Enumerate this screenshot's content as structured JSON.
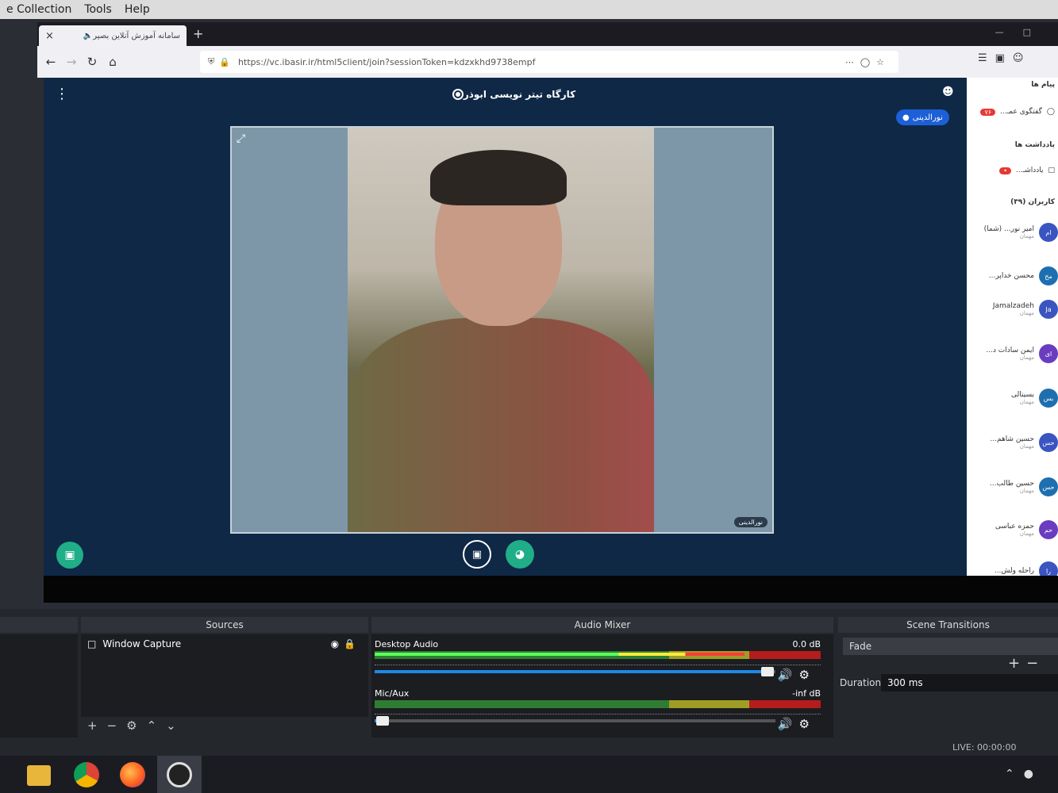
{
  "obs_menu": {
    "collection": "e Collection",
    "tools": "Tools",
    "help": "Help"
  },
  "browser": {
    "tab_title": "سامانه آموزش آنلاین بصیر",
    "tab_audio_icon": "speaker-icon",
    "url": "https://vc.ibasir.ir/html5client/join?sessionToken=kdzxkhd9738empf",
    "nav_icons": [
      "back-icon",
      "forward-icon",
      "reload-icon",
      "home-icon"
    ]
  },
  "webapp": {
    "room_title": "کارگاه تیتر نویسی ابوذر",
    "presenter_badge": "نورالدینی",
    "video_name_tag": "نورالدینی",
    "bg_color": "#0f2846"
  },
  "side_panel": {
    "users_header": "کاربران (۳۹)",
    "messages_header": "پیام ها",
    "chat_label": "گفتگوی عمـ...",
    "chat_badge": "۷۶",
    "notes_header": "یادداشت ها",
    "notes_label": "یادداشـ...",
    "users": [
      {
        "initials": "ام",
        "name": "امیر نور... (شما)",
        "status": "مهمان"
      },
      {
        "initials": "مح",
        "name": "محسن خداپر...",
        "status": ""
      },
      {
        "initials": "Ja",
        "name": "Jamalzadeh",
        "status": "مهمان"
      },
      {
        "initials": "ای",
        "name": "ایمن سادات د...",
        "status": "مهمان"
      },
      {
        "initials": "بس",
        "name": "بسیتالی",
        "status": "مهمان"
      },
      {
        "initials": "حس",
        "name": "حسین شاهم...",
        "status": "مهمان"
      },
      {
        "initials": "حس",
        "name": "حسین طالب...",
        "status": "مهمان"
      },
      {
        "initials": "حم",
        "name": "حمزه عباسی",
        "status": "مهمان"
      },
      {
        "initials": "را",
        "name": "راحله ولش...",
        "status": ""
      }
    ]
  },
  "obs": {
    "sources_title": "Sources",
    "mixer_title": "Audio Mixer",
    "transitions_title": "Scene Transitions",
    "source_item": "Window Capture",
    "desktop_audio": {
      "label": "Desktop Audio",
      "db": "0.0 dB",
      "level": 0.83,
      "volume": 0.98
    },
    "mic_aux": {
      "label": "Mic/Aux",
      "db": "-inf dB",
      "level": 0.0,
      "volume": 0.02
    },
    "transition": "Fade",
    "duration_label": "Duration",
    "duration_value": "300 ms",
    "live_status": "LIVE: 00:00:00"
  }
}
